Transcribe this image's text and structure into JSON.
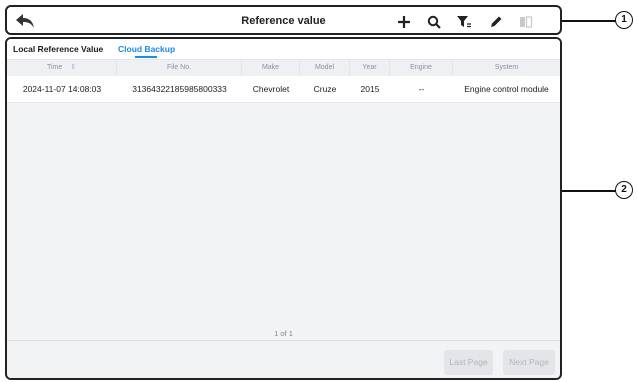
{
  "toolbar": {
    "title": "Reference value",
    "icons": [
      "back-arrow-icon",
      "add-icon",
      "search-icon",
      "filter-icon",
      "edit-icon",
      "split-view-icon"
    ]
  },
  "tabs": [
    {
      "label": "Local Reference Value",
      "active": false
    },
    {
      "label": "Cloud Backup",
      "active": true
    }
  ],
  "table": {
    "columns": [
      "Time",
      "File No.",
      "Make",
      "Model",
      "Year",
      "Engine",
      "System"
    ],
    "sort_indicator": "⇕",
    "rows": [
      [
        "2024-11-07 14:08:03",
        "31364322185985800333",
        "Chevrolet",
        "Cruze",
        "2015",
        "--",
        "Engine control module"
      ]
    ]
  },
  "pagination": {
    "page_text": "1 of 1",
    "last_label": "Last Page",
    "next_label": "Next Page"
  },
  "callouts": [
    "1",
    "2"
  ],
  "colors": {
    "accent": "#1a8be6",
    "frame": "#222222",
    "table_bg": "#f2f3f5",
    "disabled_button_bg": "#e3e5e8",
    "disabled_button_text": "#b1b5ba"
  }
}
